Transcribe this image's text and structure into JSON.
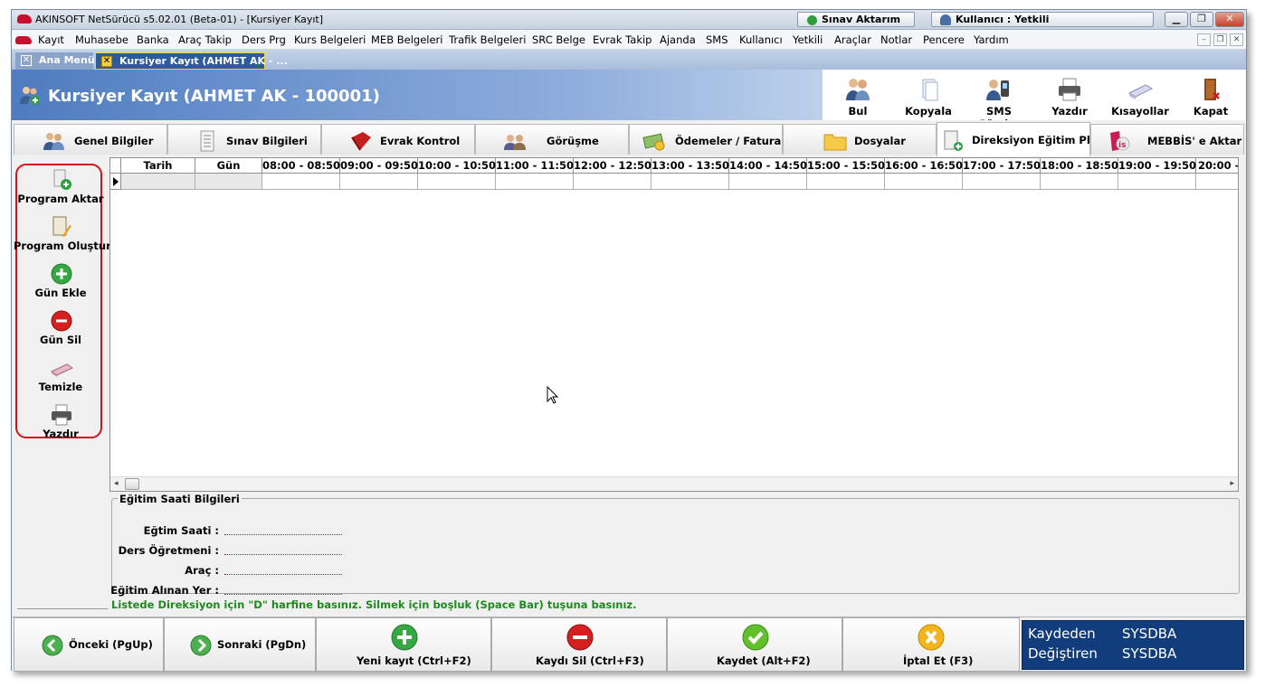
{
  "window": {
    "title": "AKINSOFT NetSürücü s5.02.01 (Beta-01) - [Kursiyer Kayıt]",
    "sinav_button": "Sınav Aktarım",
    "user_button": "Kullanıcı : Yetkili"
  },
  "menu": [
    "Kayıt",
    "Muhasebe",
    "Banka",
    "Araç Takip",
    "Ders Prg",
    "Kurs Belgeleri",
    "MEB Belgeleri",
    "Trafik Belgeleri",
    "SRC Belge",
    "Evrak Takip",
    "Ajanda",
    "SMS",
    "Kullanıcı",
    "Yetkili",
    "Araçlar",
    "Notlar",
    "Pencere",
    "Yardım"
  ],
  "doc_tabs": [
    "Ana Menü",
    "Kursiyer Kayıt (AHMET AK - ..."
  ],
  "header": {
    "title": "Kursiyer Kayıt (AHMET AK - 100001)"
  },
  "toolbar": [
    "Bul",
    "Kopyala",
    "SMS Gönder",
    "Yazdır",
    "Kısayollar",
    "Kapat"
  ],
  "tabs": [
    "Genel Bilgiler",
    "Sınav Bilgileri",
    "Evrak Kontrol",
    "Görüşme",
    "Ödemeler / Fatura",
    "Dosyalar",
    "Direksiyon Eğitim Planı",
    "MEBBİS' e Aktar"
  ],
  "left_actions": [
    "Program Aktar",
    "Program Oluştur",
    "Gün Ekle",
    "Gün Sil",
    "Temizle",
    "Yazdır"
  ],
  "grid": {
    "columns": [
      "Tarih",
      "Gün",
      "08:00 - 08:50",
      "09:00 - 09:50",
      "10:00 - 10:50",
      "11:00 - 11:50",
      "12:00 - 12:50",
      "13:00 - 13:50",
      "14:00 - 14:50",
      "15:00 - 15:50",
      "16:00 - 16:50",
      "17:00 - 17:50",
      "18:00 - 18:50",
      "19:00 - 19:50",
      "20:00 - 2"
    ]
  },
  "info": {
    "legend": "Eğitim Saati Bilgileri",
    "fields": [
      "Eğtim Saati :",
      "Ders Öğretmeni :",
      "Araç :",
      "Eğitim Alınan Yer :"
    ]
  },
  "hint": "Listede Direksiyon için \"D\" harfine basınız. Silmek için boşluk (Space Bar) tuşuna basınız.",
  "bottom": {
    "prev": "Önceki (PgUp)",
    "next": "Sonraki (PgDn)",
    "new": "Yeni kayıt (Ctrl+F2)",
    "delete": "Kaydı Sil (Ctrl+F3)",
    "save": "Kaydet (Alt+F2)",
    "cancel": "İptal Et (F3)"
  },
  "status": {
    "saved_by_label": "Kaydeden",
    "saved_by_value": "SYSDBA",
    "modified_by_label": "Değiştiren",
    "modified_by_value": "SYSDBA"
  },
  "colors": {
    "accent": "#2e5c9a",
    "status_bg": "#123d7c",
    "hint": "#1d8a1d",
    "highlight": "#d2121a"
  }
}
